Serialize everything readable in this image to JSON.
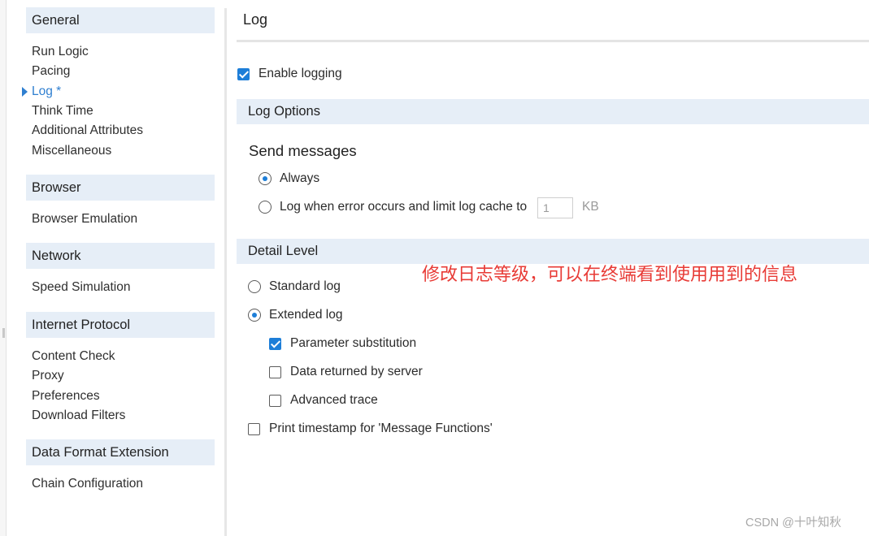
{
  "sidebar": {
    "categories": [
      {
        "title": "General",
        "items": [
          "Run Logic",
          "Pacing",
          "Log *",
          "Think Time",
          "Additional Attributes",
          "Miscellaneous"
        ]
      },
      {
        "title": "Browser",
        "items": [
          "Browser Emulation"
        ]
      },
      {
        "title": "Network",
        "items": [
          "Speed Simulation"
        ]
      },
      {
        "title": "Internet Protocol",
        "items": [
          "Content Check",
          "Proxy",
          "Preferences",
          "Download Filters"
        ]
      },
      {
        "title": "Data Format Extension",
        "items": [
          "Chain Configuration"
        ]
      }
    ],
    "active_item": "Log *",
    "active_icon": "triangle-right-icon"
  },
  "main": {
    "title": "Log",
    "enable_logging": {
      "label": "Enable logging",
      "checked": true
    },
    "log_options": {
      "header": "Log Options",
      "send_messages_title": "Send messages",
      "always": {
        "label": "Always",
        "selected": true
      },
      "on_error": {
        "label": "Log when error occurs and limit log cache to",
        "selected": false
      },
      "cache_value": "1",
      "cache_unit": "KB"
    },
    "detail_level": {
      "header": "Detail Level",
      "standard": {
        "label": "Standard log",
        "selected": false
      },
      "extended": {
        "label": "Extended log",
        "selected": true
      },
      "parameter_substitution": {
        "label": "Parameter substitution",
        "checked": true
      },
      "data_returned": {
        "label": "Data returned by server",
        "checked": false
      },
      "advanced_trace": {
        "label": "Advanced trace",
        "checked": false
      },
      "print_timestamp": {
        "label": "Print timestamp for 'Message Functions'",
        "checked": false
      }
    }
  },
  "annotation": "修改日志等级，可以在终端看到使用用到的信息",
  "watermark": "CSDN @十叶知秋",
  "colors": {
    "accent": "#1d7ed8",
    "section_bg": "#e6eef7",
    "annotation": "#e83b36",
    "active_nav": "#2f7fd0"
  }
}
